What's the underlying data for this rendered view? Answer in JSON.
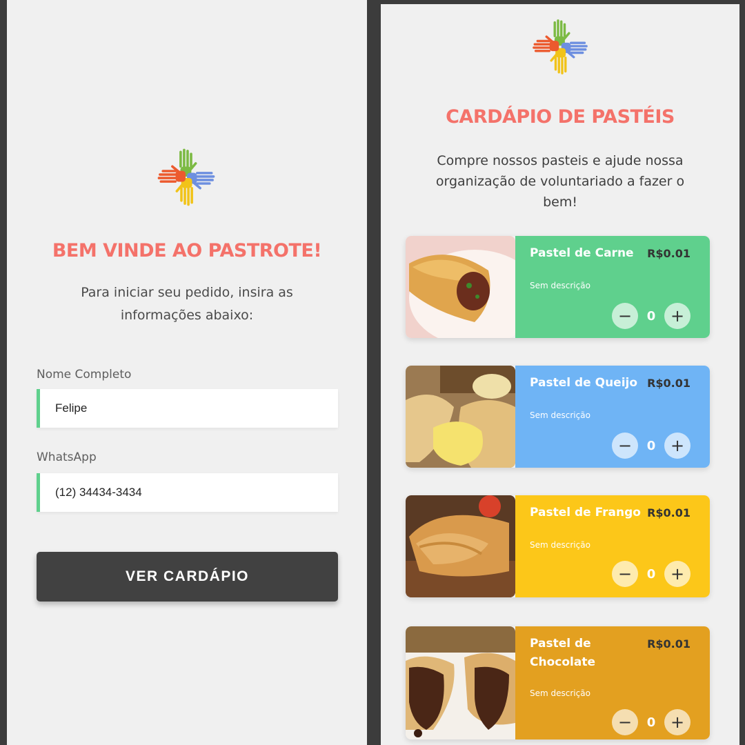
{
  "login": {
    "logo": "hands-logo",
    "title": "BEM VINDE AO PASTROTE!",
    "subtitle": "Para iniciar seu pedido, insira as informações abaixo:",
    "name_label": "Nome Completo",
    "name_value": "Felipe",
    "whatsapp_label": "WhatsApp",
    "whatsapp_value": "(12) 34434-3434",
    "button_label": "VER CARDÁPIO"
  },
  "menu": {
    "logo": "hands-logo",
    "title": "CARDÁPIO DE PASTÉIS",
    "subtitle": "Compre nossos pasteis e ajude nossa organização de voluntariado a fazer o bem!",
    "items": [
      {
        "name": "Pastel de Carne",
        "price": "R$0.01",
        "description": "Sem descrição",
        "quantity": "0",
        "color": "#5fd08d",
        "image": "pastel-carne-photo"
      },
      {
        "name": "Pastel de Queijo",
        "price": "R$0.01",
        "description": "Sem descrição",
        "quantity": "0",
        "color": "#6fb4f5",
        "image": "pastel-queijo-photo"
      },
      {
        "name": "Pastel de Frango",
        "price": "R$0.01",
        "description": "Sem descrição",
        "quantity": "0",
        "color": "#fcc719",
        "image": "pastel-frango-photo"
      },
      {
        "name": "Pastel de Chocolate",
        "price": "R$0.01",
        "description": "Sem descrição",
        "quantity": "0",
        "color": "#e3a020",
        "image": "pastel-chocolate-photo"
      }
    ],
    "decrement_symbol": "−",
    "increment_symbol": "+"
  }
}
